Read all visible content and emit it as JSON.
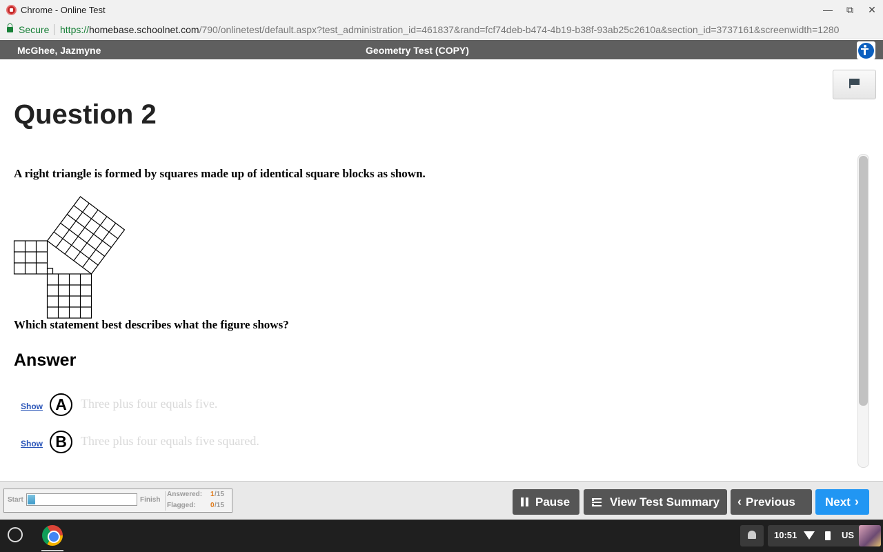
{
  "window": {
    "title": "Chrome - Online Test"
  },
  "address": {
    "secure_label": "Secure",
    "url_scheme": "https://",
    "url_host": "homebase.schoolnet.com",
    "url_path": "/790/onlinetest/default.aspx?test_administration_id=461837&rand=fcf74deb-b474-4b19-b38f-93ab25c2610a&section_id=3737161&screenwidth=1280"
  },
  "header": {
    "student_name": "McGhee, Jazmyne",
    "test_name": "Geometry Test (COPY)"
  },
  "question": {
    "title": "Question 2",
    "stem": "A right triangle is formed by squares made up of identical square blocks as shown.",
    "prompt": "Which statement best describes what the figure shows?",
    "answer_heading": "Answer",
    "figure": {
      "legs": [
        3,
        4
      ],
      "hypotenuse": 5
    },
    "choices": [
      {
        "show": "Show",
        "letter": "A",
        "text": "Three plus four equals five."
      },
      {
        "show": "Show",
        "letter": "B",
        "text": "Three plus four equals five squared."
      }
    ]
  },
  "footer": {
    "start_label": "Start",
    "finish_label": "Finish",
    "progress_fraction": 0.067,
    "answered_label": "Answered:",
    "answered_value": "1",
    "answered_total": "/15",
    "flagged_label": "Flagged:",
    "flagged_value": "0",
    "flagged_total": "/15",
    "pause_label": "Pause",
    "summary_label": "View Test Summary",
    "previous_label": "Previous",
    "next_label": "Next"
  },
  "taskbar": {
    "time": "10:51",
    "locale": "US"
  },
  "colors": {
    "header_bg": "#5f5f5f",
    "next_button": "#2196f3",
    "dark_button": "#555555",
    "secure_green": "#188038",
    "link_blue": "#2a55b8"
  },
  "icons": [
    "close-icon",
    "lock-icon",
    "accessibility-icon",
    "flag-icon",
    "pause-icon",
    "list-icon",
    "chevron-left-icon",
    "chevron-right-icon",
    "launcher-icon",
    "chrome-icon",
    "bell-icon",
    "wifi-icon",
    "battery-icon"
  ]
}
